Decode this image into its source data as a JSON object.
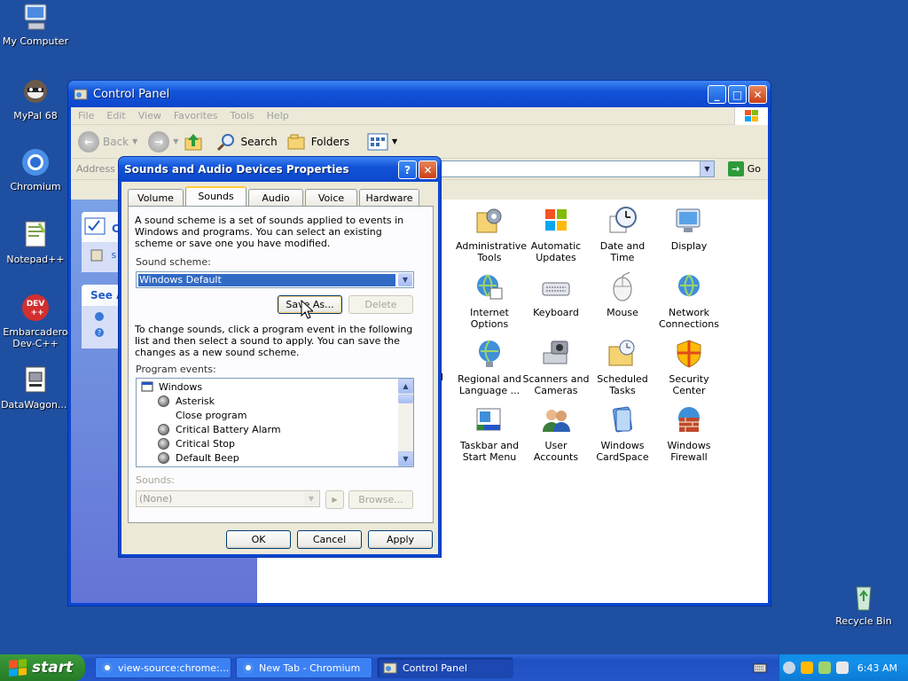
{
  "desktop_icons": [
    {
      "label": "My Computer",
      "icon": "my-computer-icon"
    },
    {
      "label": "MyPal 68",
      "icon": "mypal-icon"
    },
    {
      "label": "Chromium",
      "icon": "chromium-icon"
    },
    {
      "label": "Notepad++",
      "icon": "notepadpp-icon"
    },
    {
      "label": "Embarcadero Dev-C++",
      "icon": "devcpp-icon"
    },
    {
      "label": "DataWagon....",
      "icon": "datawagon-icon"
    },
    {
      "label": "Recycle Bin",
      "icon": "recycle-bin-icon"
    }
  ],
  "control_panel": {
    "title": "Control Panel",
    "menu": [
      "File",
      "Edit",
      "View",
      "Favorites",
      "Tools",
      "Help"
    ],
    "toolbar": {
      "back": "Back",
      "search": "Search",
      "folders": "Folders"
    },
    "address_label": "Address",
    "go_label": "Go",
    "left_pane": {
      "see_also": "See A"
    },
    "items": [
      {
        "label": "Administrative Tools"
      },
      {
        "label": "Automatic Updates"
      },
      {
        "label": "Date and Time"
      },
      {
        "label": "Display"
      },
      {
        "label": "Internet Options"
      },
      {
        "label": "Keyboard"
      },
      {
        "label": "Mouse"
      },
      {
        "label": "Network Connections"
      },
      {
        "label": "Regional and Language ..."
      },
      {
        "label": "Scanners and Cameras"
      },
      {
        "label": "Scheduled Tasks"
      },
      {
        "label": "Security Center"
      },
      {
        "label": "Taskbar and Start Menu"
      },
      {
        "label": "User Accounts"
      },
      {
        "label": "Windows CardSpace"
      },
      {
        "label": "Windows Firewall"
      }
    ],
    "partial_texts": {
      "s": "s",
      "nd": "nd"
    }
  },
  "dialog": {
    "title": "Sounds and Audio Devices Properties",
    "help_glyph": "?",
    "tabs": [
      "Volume",
      "Sounds",
      "Audio",
      "Voice",
      "Hardware"
    ],
    "active_tab": "Sounds",
    "intro_text": "A sound scheme is a set of sounds applied to events in Windows and programs. You can select an existing scheme or save one you have modified.",
    "scheme_label": "Sound scheme:",
    "scheme_value": "Windows Default",
    "save_as": "Save As...",
    "delete": "Delete",
    "change_text": "To change sounds, click a program event in the following list and then select a sound to apply. You can save the changes as a new sound scheme.",
    "events_label": "Program events:",
    "events": [
      {
        "label": "Windows",
        "speaker": false,
        "root": true
      },
      {
        "label": "Asterisk",
        "speaker": true
      },
      {
        "label": "Close program",
        "speaker": false
      },
      {
        "label": "Critical Battery Alarm",
        "speaker": true
      },
      {
        "label": "Critical Stop",
        "speaker": true
      },
      {
        "label": "Default Beep",
        "speaker": true
      }
    ],
    "sounds_label": "Sounds:",
    "sounds_value": "(None)",
    "browse": "Browse...",
    "ok": "OK",
    "cancel": "Cancel",
    "apply": "Apply"
  },
  "taskbar": {
    "start": "start",
    "tasks": [
      {
        "label": "view-source:chrome:..."
      },
      {
        "label": "New Tab - Chromium"
      },
      {
        "label": "Control Panel"
      }
    ],
    "clock": "6:43 AM"
  },
  "colors": {
    "desktop": "#1f4fa0",
    "title_blue": "#0c47cc",
    "selection": "#316ac5",
    "start_green": "#2f8a2f"
  }
}
